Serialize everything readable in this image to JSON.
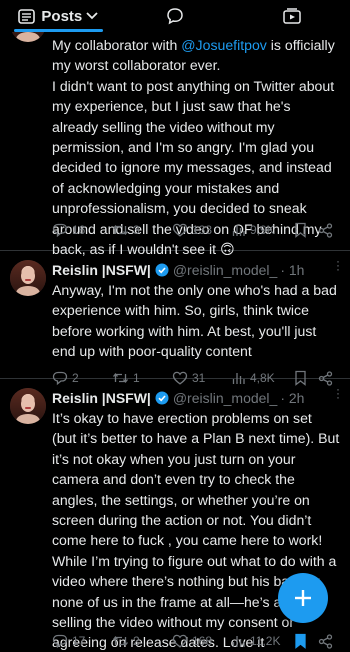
{
  "header": {
    "tab_label": "Posts"
  },
  "tweets": [
    {
      "text_before_mention": "My collaborator with ",
      "mention": "@Josuefitpov",
      "text_after_mention": " is officially my worst collaborator ever.",
      "body": "I didn't want to post anything on Twitter about my experience, but I just saw that he's already selling the video without my permission, and I'm so angry. I'm glad you decided to ignore my messages, and instead of acknowledging your mistakes and unprofessionalism, you decided to sneak around and sell the video on OF behind my back, as if I wouldn't see it 🙃",
      "replies": "16",
      "reposts": "3",
      "likes": "133",
      "views": "9,9K"
    },
    {
      "name": "Reislin |NSFW|",
      "handle": "@reislin_model_",
      "time": "· 1h",
      "body": "Anyway, I'm not the only one who's had a bad experience with him. So, girls, think twice before working with him. At best, you'll just end up with poor-quality content",
      "replies": "2",
      "reposts": "1",
      "likes": "31",
      "views": "4,8K"
    },
    {
      "name": "Reislin |NSFW|",
      "handle": "@reislin_model_",
      "time": "· 2h",
      "body": "It’s okay to have erection problems on set (but it’s better to have a Plan B next time). But it’s not okay when you just turn on your camera and don’t even try to check the angles, the settings, or whether you’re on screen during the action or not. You didn’t come here to fuck , you came here to work! While I’m trying to figure out what to do with a video where there’s nothing but his back or none of us in the frame at all—he’s already selling the video without my consent or agreeing on release dates. Love it",
      "replies": "17",
      "reposts": "2",
      "likes": "168",
      "views": "11,2K"
    }
  ],
  "colors": {
    "accent": "#1d9bf0",
    "text": "#e7e9ea",
    "muted": "#71767b",
    "background": "#000000"
  },
  "icons": [
    "posts-list-icon",
    "chevron-down-icon",
    "chat-bubble-icon",
    "media-icon",
    "reply-icon",
    "repost-icon",
    "like-icon",
    "views-icon",
    "bookmark-icon",
    "share-icon",
    "verified-icon",
    "more-icon",
    "compose-plus-icon"
  ]
}
